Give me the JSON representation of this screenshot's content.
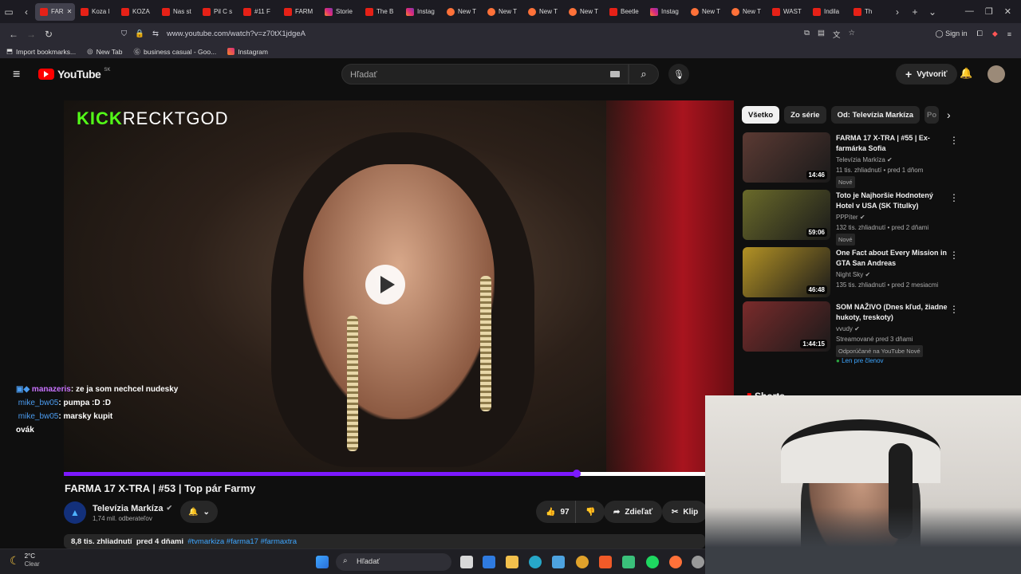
{
  "browser": {
    "tabs": [
      "FAR",
      "Koza l",
      "KOZA",
      "Nas st",
      "Pil C s",
      "#11 F",
      "FARM",
      "Storie",
      "The B",
      "Instag",
      "New T",
      "New T",
      "New T",
      "New T",
      "Beetle",
      "Instag",
      "New T",
      "New T",
      "WAST",
      "Indila",
      "Th"
    ],
    "url": "www.youtube.com/watch?v=z70tX1jdgeA",
    "sign_in": "Sign in",
    "bookmarks": [
      "Import bookmarks...",
      "New Tab",
      "business casual - Goo...",
      "Instagram"
    ]
  },
  "youtube": {
    "logo_text": "YouTube",
    "region": "SK",
    "search_placeholder": "Hľadať",
    "create_label": "Vytvoriť"
  },
  "video": {
    "overlay_brand": "KICK",
    "overlay_channel": "RECKTGOD",
    "progress_fraction": 0.8,
    "title": "FARMA 17 X-TRA | #53 | Top pár Farmy",
    "channel": "Televízia Markíza",
    "subscribers": "1,74 mil. odberateľov",
    "likes": "97",
    "share_label": "Zdieľať",
    "clip_label": "Klip",
    "views": "8,8 tis. zhliadnutí",
    "date": "pred 4 dňami",
    "tags": "#tvmarkiza #farma17 #farmaxtra"
  },
  "chat": [
    {
      "user": "manazeris",
      "text": ": ze ja som nechcel nudesky"
    },
    {
      "user": "mike_bw05",
      "text": ": pumpa :D :D"
    },
    {
      "user": "mike_bw05",
      "text": ": marsky kupit"
    },
    {
      "user": "",
      "text": "ovák"
    }
  ],
  "sidebar": {
    "chips": [
      "Všetko",
      "Zo série",
      "Od: Televízia Markíza",
      "Po"
    ],
    "recs": [
      {
        "title": "FARMA 17 X-TRA | #55 | Ex-farmárka Sofia",
        "channel": "Televízia Markíza",
        "stats": "11 tis. zhliadnutí • pred 1 dňom",
        "badge": "Nové",
        "duration": "14:46",
        "thumb": "#5b3a33"
      },
      {
        "title": "Toto je Najhoršie Hodnotený Hotel v USA (SK Titulky)",
        "channel": "PPPíter",
        "stats": "132 tis. zhliadnutí • pred 2 dňami",
        "badge": "Nové",
        "duration": "59:06",
        "thumb": "#6a6a2a"
      },
      {
        "title": "One Fact about Every Mission in GTA San Andreas",
        "channel": "Night Sky",
        "stats": "135 tis. zhliadnutí • pred 2 mesiacmi",
        "badge": "",
        "duration": "46:48",
        "thumb": "#b39225"
      },
      {
        "title": "SOM NAŽIVO (Dnes kľud, žiadne hukoty, treskoty)",
        "channel": "vvudy",
        "stats": "Streamované pred 3 dňami",
        "badge": "Odporúčané na YouTube  Nové",
        "extra": "Len pre členov",
        "duration": "1:44:15",
        "thumb": "#7a2b2b"
      }
    ],
    "shorts_heading": "Shorts"
  },
  "taskbar": {
    "weather_temp": "2°C",
    "weather_text": "Clear",
    "search_text": "Hľadať"
  }
}
